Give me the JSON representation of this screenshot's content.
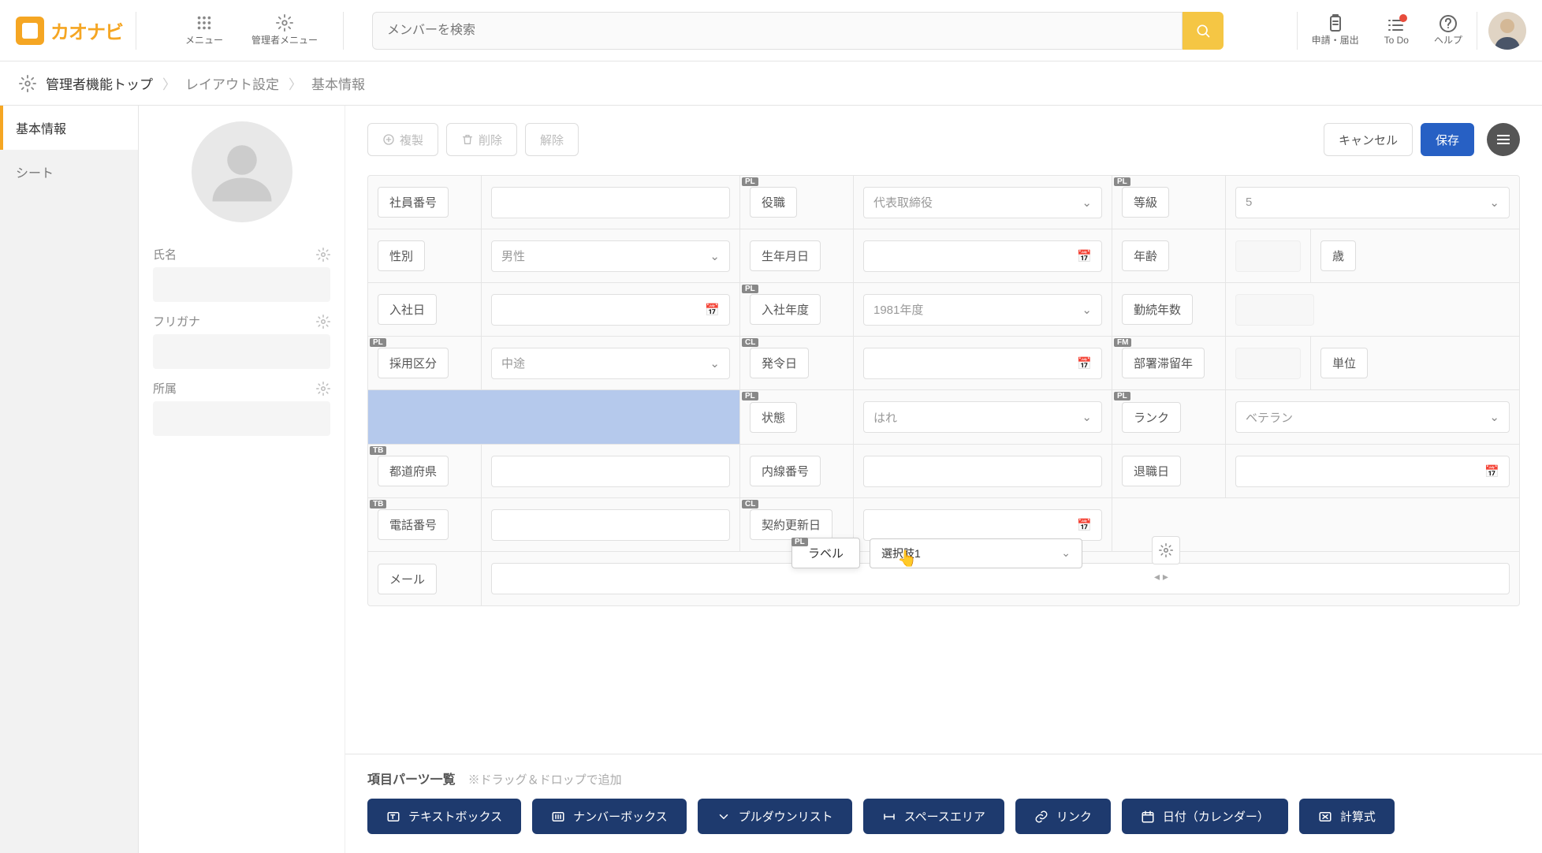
{
  "header": {
    "logo_text": "カオナビ",
    "menu_label": "メニュー",
    "admin_menu_label": "管理者メニュー",
    "search_placeholder": "メンバーを検索",
    "request_label": "申請・届出",
    "todo_label": "To Do",
    "help_label": "ヘルプ"
  },
  "breadcrumb": {
    "top": "管理者機能トップ",
    "layout": "レイアウト設定",
    "current": "基本情報"
  },
  "left_nav": {
    "basic_info": "基本情報",
    "sheet": "シート"
  },
  "profile": {
    "name_label": "氏名",
    "furigana_label": "フリガナ",
    "belonging_label": "所属"
  },
  "toolbar": {
    "duplicate": "複製",
    "delete": "削除",
    "release": "解除",
    "cancel": "キャンセル",
    "save": "保存"
  },
  "fields": {
    "employee_no": "社員番号",
    "position": "役職",
    "position_ph": "代表取締役",
    "grade": "等級",
    "grade_ph": "5",
    "gender": "性別",
    "gender_ph": "男性",
    "birthday": "生年月日",
    "age": "年齢",
    "age_unit": "歳",
    "hire_date": "入社日",
    "hire_year": "入社年度",
    "hire_year_ph": "1981年度",
    "years": "勤続年数",
    "hire_type": "採用区分",
    "hire_type_ph": "中途",
    "order_date": "発令日",
    "dept_stay": "部署滞留年",
    "dept_unit": "単位",
    "status": "状態",
    "status_ph": "はれ",
    "rank": "ランク",
    "rank_ph": "ベテラン",
    "prefecture": "都道府県",
    "inline_no": "内線番号",
    "retire_date": "退職日",
    "phone": "電話番号",
    "contract_renew": "契約更新日",
    "mail": "メール"
  },
  "drag": {
    "label": "ラベル",
    "option": "選択肢1"
  },
  "parts": {
    "title": "項目パーツ一覧",
    "hint": "※ドラッグ＆ドロップで追加",
    "textbox": "テキストボックス",
    "numberbox": "ナンバーボックス",
    "pulldown": "プルダウンリスト",
    "space": "スペースエリア",
    "link": "リンク",
    "date": "日付（カレンダー）",
    "formula": "計算式"
  },
  "badges": {
    "PL": "PL",
    "CL": "CL",
    "TB": "TB",
    "FM": "FM"
  }
}
